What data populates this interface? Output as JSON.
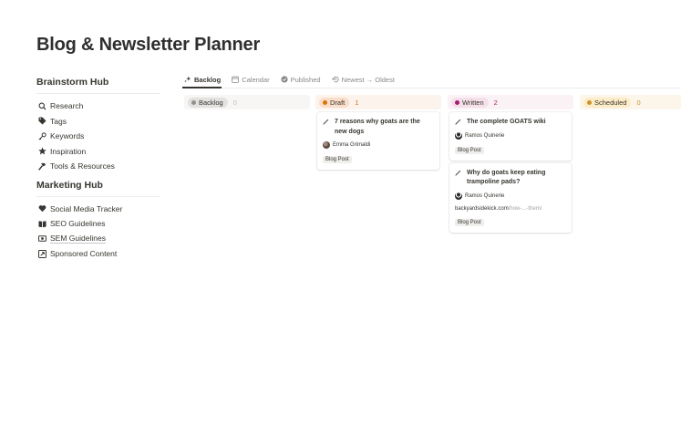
{
  "page": {
    "title": "Blog & Newsletter Planner"
  },
  "sidebar": {
    "brainstorm": {
      "title": "Brainstorm Hub",
      "items": [
        {
          "label": "Research",
          "icon": "search-icon"
        },
        {
          "label": "Tags",
          "icon": "tag-icon"
        },
        {
          "label": "Keywords",
          "icon": "key-icon"
        },
        {
          "label": "Inspiration",
          "icon": "star-icon"
        },
        {
          "label": "Tools & Resources",
          "icon": "hammer-icon"
        }
      ]
    },
    "marketing": {
      "title": "Marketing Hub",
      "items": [
        {
          "label": "Social Media Tracker",
          "icon": "heart-icon"
        },
        {
          "label": "SEO Guidelines",
          "icon": "book-icon"
        },
        {
          "label": "SEM Guidelines",
          "icon": "money-icon"
        },
        {
          "label": "Sponsored Content",
          "icon": "sponsored-icon"
        }
      ]
    }
  },
  "tabs": [
    {
      "label": "Backlog",
      "icon": "sparkle-icon",
      "active": true
    },
    {
      "label": "Calendar",
      "icon": "calendar-icon"
    },
    {
      "label": "Published",
      "icon": "check-circle-icon"
    },
    {
      "label": "Newest → Oldest",
      "icon": "history-icon"
    }
  ],
  "columns": [
    {
      "label": "Backlog",
      "count": "0",
      "dot": "#91918e",
      "pill_bg": "#e3e2e0",
      "col_bg": "#f7f6f5",
      "count_color": "#c3c2bf"
    },
    {
      "label": "Draft",
      "count": "1",
      "dot": "#d9730d",
      "pill_bg": "#fadec9",
      "col_bg": "#fcf3ec",
      "count_color": "#d9730d"
    },
    {
      "label": "Written",
      "count": "2",
      "dot": "#ad1a72",
      "pill_bg": "#f5e0e9",
      "col_bg": "#fbf2f6",
      "count_color": "#ad1a72"
    },
    {
      "label": "Scheduled",
      "count": "0",
      "dot": "#cb912f",
      "pill_bg": "#fdecc8",
      "col_bg": "#fbf6e9",
      "count_color": "#cb912f"
    }
  ],
  "cards": {
    "draft_1": {
      "title": "7 reasons why goats are the new dogs",
      "author": "Emma Grimaldi",
      "tag": "Blog Post"
    },
    "written_1": {
      "title": "The complete GOATS wiki",
      "author": "Ramos Quinerie",
      "tag": "Blog Post"
    },
    "written_2": {
      "title": "Why do goats keep eating trampoline pads?",
      "author": "Ramos Quinerie",
      "url_main": "backyardsidekick.com",
      "url_dim": "/how-...-them/",
      "tag": "Blog Post"
    }
  }
}
